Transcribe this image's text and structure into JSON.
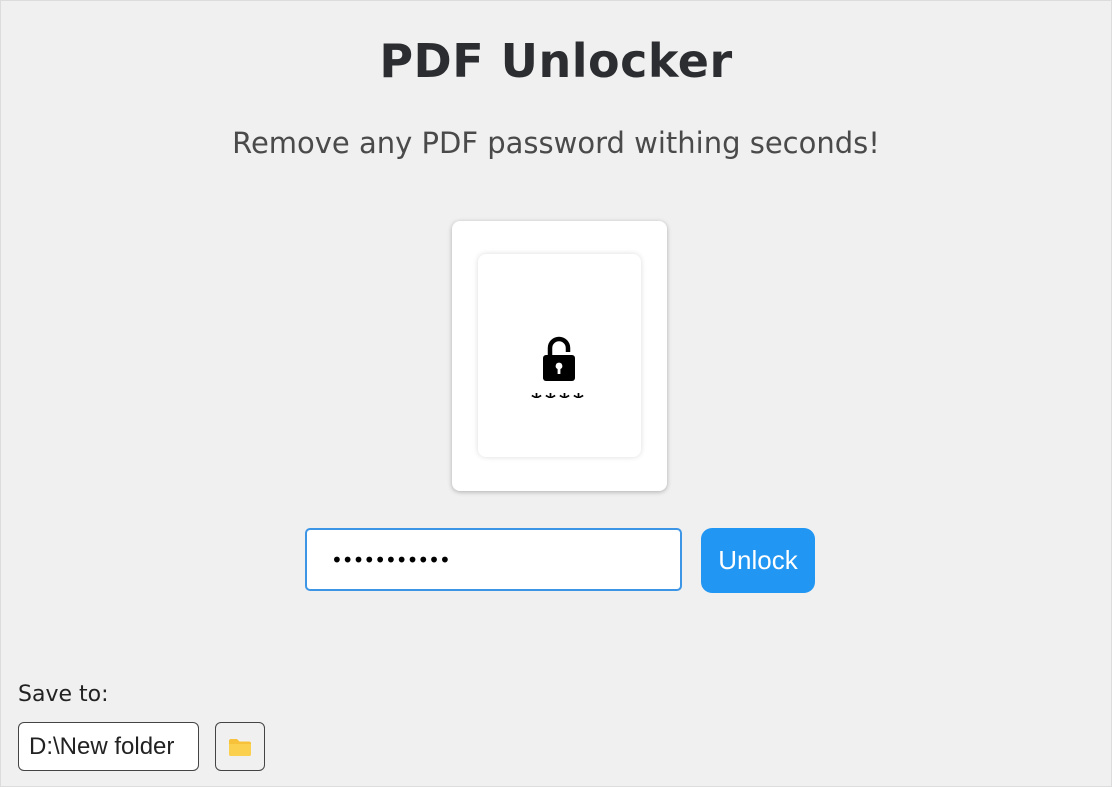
{
  "header": {
    "title": "PDF Unlocker",
    "subtitle": "Remove any PDF password withing seconds!"
  },
  "drop_zone": {
    "icon": "lock-password-icon",
    "password_glyph": "****"
  },
  "unlock_form": {
    "password_value": "•••••••••••",
    "unlock_label": "Unlock"
  },
  "save": {
    "label": "Save to:",
    "folder_path": "D:\\New folder",
    "browse_icon": "folder-icon"
  },
  "colors": {
    "accent": "#2196f3",
    "background": "#f0f0f0",
    "folder": "#f8c13a"
  }
}
